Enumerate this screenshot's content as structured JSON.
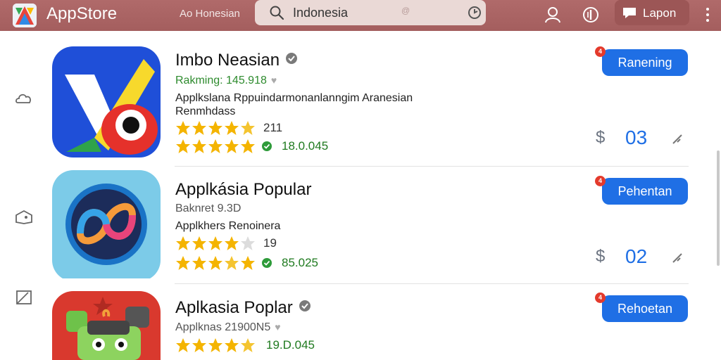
{
  "header": {
    "brand": "AppStore",
    "store_label": "Ao Honesian",
    "search_value": "Indonesia",
    "search_hint": "@",
    "language_label": "Lapon"
  },
  "apps": [
    {
      "title": "Imbo Neasian",
      "subtitle": "Rakming: 145.918",
      "subtitle_color": "green",
      "desc_line1": "Applkslana Rppuindarmonanlanngim Aranesian",
      "desc_line2": "Renmhdass",
      "rating_count": "211",
      "downloads": "18.0.045",
      "button_label": "Ranening",
      "badge": "4",
      "price_symbol": "$",
      "count": "03"
    },
    {
      "title": "Applkásia Popular",
      "subtitle": "Baknret 9.3D",
      "subtitle_color": "gray",
      "desc_line1": "Applkhers Renoinera",
      "desc_line2": "",
      "rating_count": "19",
      "downloads": "85.025",
      "button_label": "Pehentan",
      "badge": "4",
      "price_symbol": "$",
      "count": "02"
    },
    {
      "title": "Aplkasia Poplar",
      "subtitle": "Applknas 21900N5",
      "subtitle_color": "gray",
      "desc_line1": "",
      "desc_line2": "",
      "rating_count": "",
      "downloads": "19.D.045",
      "button_label": "Rehoetan",
      "badge": "4",
      "price_symbol": "",
      "count": ""
    }
  ],
  "colors": {
    "header": "#a45e5e",
    "accent": "#1f6fe5",
    "star": "#f4b400",
    "badge": "#e43a2c"
  },
  "icons": {
    "header": [
      "profile-icon",
      "info-icon",
      "chat-icon",
      "more-icon"
    ],
    "side": [
      "cloud-icon",
      "tag-icon",
      "cast-icon"
    ]
  }
}
